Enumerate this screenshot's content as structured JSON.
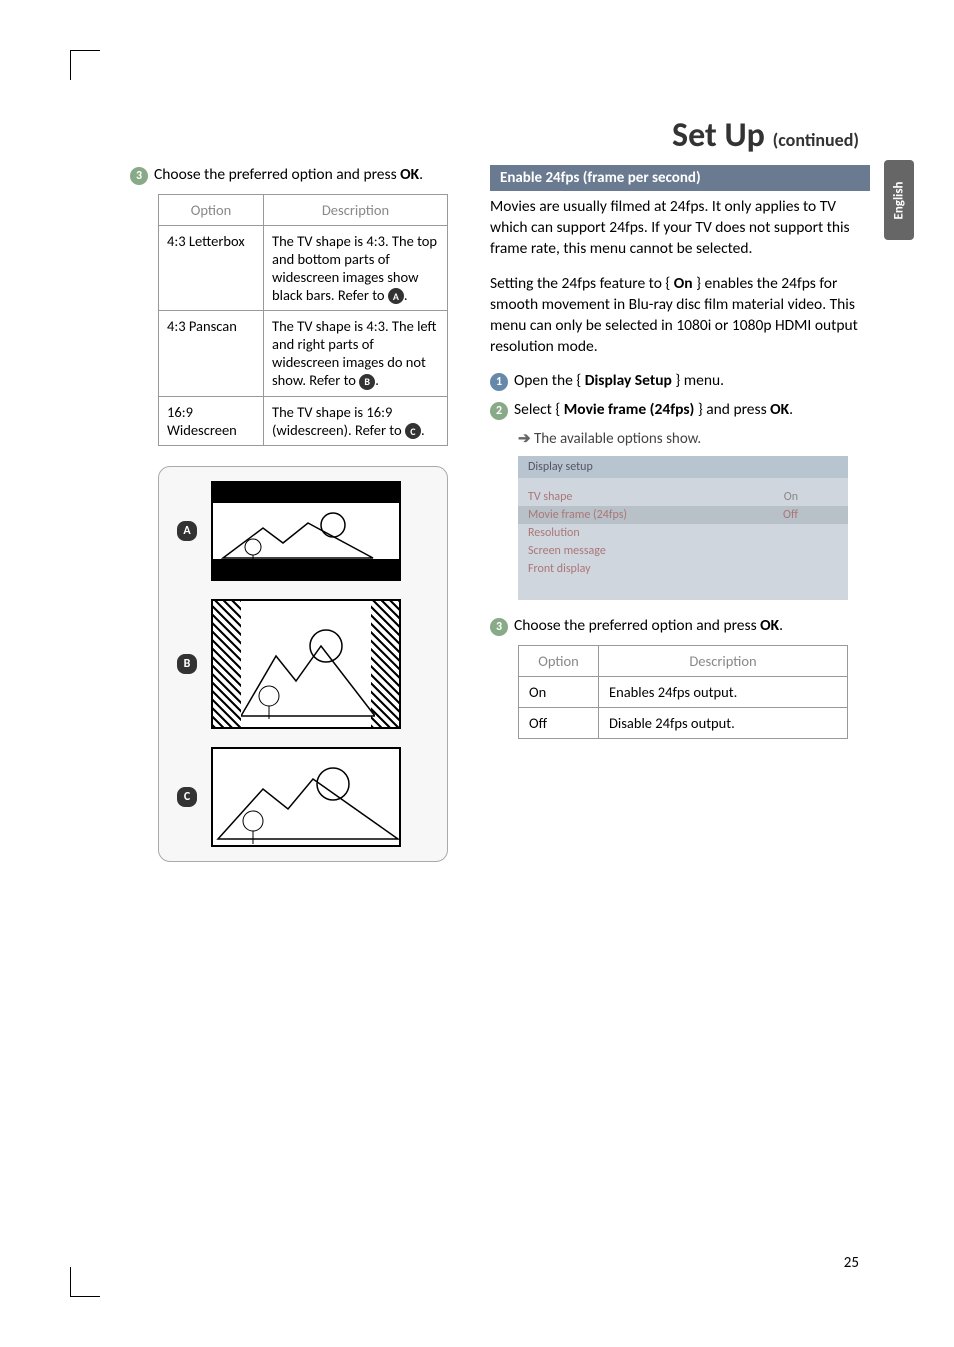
{
  "header": {
    "title": "Set Up",
    "subtitle": "(continued)",
    "language_tab": "English"
  },
  "left": {
    "step3_badge": "3",
    "step3_text_a": "Choose the preferred option and press ",
    "step3_text_b": "OK",
    "step3_text_c": ".",
    "table": {
      "head_option": "Option",
      "head_desc": "Description",
      "rows": [
        {
          "opt": "4:3 Letterbox",
          "desc": "The TV shape is 4:3. The top and bottom parts of widescreen images show black bars. Refer to ",
          "ref": "A",
          "tail": "."
        },
        {
          "opt": "4:3 Panscan",
          "desc": "The TV shape is 4:3. The left and right parts of widescreen images do not show. Refer to ",
          "ref": "B",
          "tail": "."
        },
        {
          "opt": "16:9 Widescreen",
          "desc": "The TV shape is 16:9 (widescreen). Refer to ",
          "ref": "C",
          "tail": "."
        }
      ]
    },
    "diag_labels": {
      "a": "A",
      "b": "B",
      "c": "C"
    }
  },
  "right": {
    "section_title": "Enable 24fps (frame per second)",
    "para1": "Movies are usually filmed at 24fps. It only applies to TV which can support 24fps. If your TV does not support this frame rate, this menu cannot be selected.",
    "para2_a": "Setting the 24fps feature to { ",
    "para2_b": "On",
    "para2_c": " } enables the 24fps for smooth movement in Blu-ray disc film material video. This menu can only be selected in 1080i or 1080p HDMI output resolution mode.",
    "step1_badge": "1",
    "step1_a": "Open the { ",
    "step1_b": "Display Setup",
    "step1_c": " } menu.",
    "step2_badge": "2",
    "step2_a": "Select { ",
    "step2_b": "Movie frame (24fps)",
    "step2_c": " } and press ",
    "step2_d": "OK",
    "step2_e": ".",
    "step2_sub": "The available options show.",
    "menu": {
      "title": "Display setup",
      "rows": [
        {
          "label": "TV shape",
          "value": "On"
        },
        {
          "label": "Movie frame (24fps)",
          "value": "Off",
          "selected": true
        },
        {
          "label": "Resolution",
          "value": ""
        },
        {
          "label": "Screen message",
          "value": ""
        },
        {
          "label": "Front display",
          "value": ""
        }
      ]
    },
    "step3_badge": "3",
    "step3_a": "Choose the preferred option and press ",
    "step3_b": "OK",
    "step3_c": ".",
    "table": {
      "head_option": "Option",
      "head_desc": "Description",
      "rows": [
        {
          "opt": "On",
          "desc": "Enables 24fps output."
        },
        {
          "opt": "Off",
          "desc": "Disable 24fps output."
        }
      ]
    }
  },
  "page_number": "25"
}
